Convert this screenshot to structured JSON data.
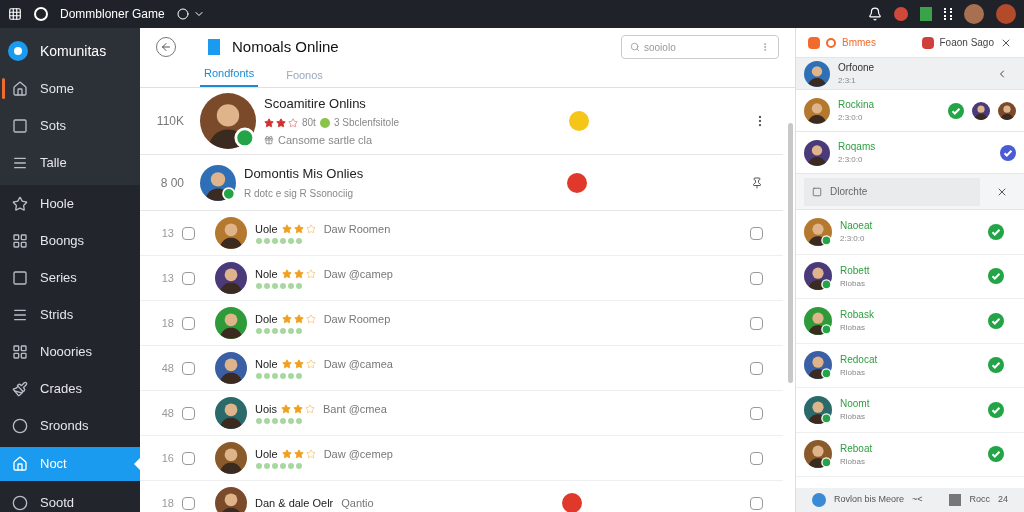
{
  "topbar": {
    "title": "Dommbloner Game"
  },
  "sidebar": {
    "brand": "Komunitas",
    "items": [
      {
        "label": "Some",
        "kind": "home",
        "selected": false,
        "flag": true
      },
      {
        "label": "Sots",
        "kind": "square",
        "selected": false,
        "flag": false
      },
      {
        "label": "Talle",
        "kind": "lines",
        "selected": false,
        "flag": false
      },
      {
        "label": "Hoole",
        "kind": "star",
        "selected": false,
        "flag": false
      },
      {
        "label": "Boongs",
        "kind": "grid",
        "selected": false,
        "flag": false
      },
      {
        "label": "Series",
        "kind": "square",
        "selected": false,
        "flag": false
      },
      {
        "label": "Strids",
        "kind": "lines",
        "selected": false,
        "flag": false
      },
      {
        "label": "Nooories",
        "kind": "grid",
        "selected": false,
        "flag": false
      },
      {
        "label": "Crades",
        "kind": "brush",
        "selected": false,
        "flag": false
      },
      {
        "label": "Sroonds",
        "kind": "circle",
        "selected": false,
        "flag": false
      },
      {
        "label": "Noct",
        "kind": "home",
        "selected": true,
        "flag": false
      },
      {
        "label": "Sootd",
        "kind": "circle",
        "selected": false,
        "flag": false
      }
    ]
  },
  "main": {
    "title": "Nomoals Online",
    "search": {
      "placeholder": "sooiolo"
    },
    "tabs": [
      {
        "label": "Rondfonts",
        "selected": true
      },
      {
        "label": "Foonos",
        "selected": false
      }
    ],
    "rows": [
      {
        "kind": "featured",
        "count": "110K",
        "title": "Scoamitire Onlins",
        "stars": 2,
        "meta": "80t",
        "meta2": "3 Sbclenfsitole",
        "detail": "Cansome sartle cla",
        "color": "#f5c518",
        "has_menu": true
      },
      {
        "kind": "featured",
        "count": "8 00",
        "title": "Domontis Mis Onlies",
        "meta2": "R dotc e sig R Ssonociig",
        "color": "#e0392b",
        "has_menu": false
      },
      {
        "kind": "item",
        "count": "13",
        "checked": false,
        "name": "Uole",
        "stars": 2,
        "text": "Daw Roomen",
        "right_checked": false
      },
      {
        "kind": "item",
        "count": "13",
        "checked": false,
        "name": "Nole",
        "stars": 2,
        "text": "Daw @camep",
        "right_checked": false
      },
      {
        "kind": "item",
        "count": "18",
        "checked": false,
        "name": "Dole",
        "stars": 2,
        "text": "Daw Roomep",
        "right_checked": false
      },
      {
        "kind": "item",
        "count": "48",
        "checked": false,
        "name": "Nole",
        "stars": 2,
        "text": "Daw @camea",
        "right_checked": false
      },
      {
        "kind": "item",
        "count": "48",
        "checked": false,
        "name": "Uois",
        "stars": 2,
        "text": "Bant @cmea",
        "right_checked": false
      },
      {
        "kind": "item",
        "count": "16",
        "checked": false,
        "name": "Uole",
        "stars": 2,
        "text": "Daw @cemep",
        "right_checked": false
      },
      {
        "kind": "item",
        "count": "18",
        "checked": false,
        "name": "Dan & dale Oelr",
        "text": "Qantio",
        "right_checked": false,
        "color": "#e0392b"
      }
    ]
  },
  "panel": {
    "tab": "Bmmes",
    "game": "Foaon Sago",
    "friends": [
      {
        "kind": "header",
        "name": "Orfoone",
        "sub": "2:3:1"
      },
      {
        "kind": "group",
        "name": "Rockina",
        "sub": "2:3:0:0",
        "color": "#22a447"
      },
      {
        "kind": "friend",
        "name": "Roqams",
        "sub": "2:3:0:0",
        "color": "#4a5bd6"
      }
    ],
    "filter": {
      "placeholder": "Dlorchte"
    },
    "online": [
      {
        "name": "Naoeat",
        "sub": "2:3:0:0"
      },
      {
        "name": "Robett",
        "sub": "Rlobas"
      },
      {
        "name": "Robask",
        "sub": "Rlobas"
      },
      {
        "name": "Redocat",
        "sub": "Rlobas"
      },
      {
        "name": "Noomt",
        "sub": "Rlobas"
      },
      {
        "name": "Reboat",
        "sub": "Rlobas"
      }
    ],
    "footer": {
      "label": "Rovlon bis Meore",
      "mark": "~<",
      "count_label": "Rocc",
      "count": "24"
    }
  }
}
